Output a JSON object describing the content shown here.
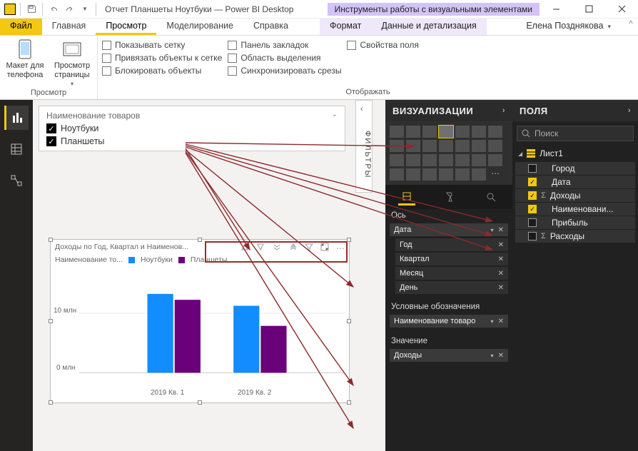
{
  "window": {
    "title": "Отчет Планшеты Ноутбуки — Power BI Desktop",
    "context_tools": "Инструменты работы с визуальными элементами",
    "user": "Елена Позднякова"
  },
  "tabs": {
    "file": "Файл",
    "home": "Главная",
    "view": "Просмотр",
    "modeling": "Моделирование",
    "help": "Справка",
    "format": "Формат",
    "data_detail": "Данные и детализация"
  },
  "ribbon": {
    "phone_layout": "Макет для телефона",
    "page_view": "Просмотр страницы",
    "group1_label": "Просмотр",
    "show_grid": "Показывать сетку",
    "snap_grid": "Привязать объекты к сетке",
    "lock_objects": "Блокировать объекты",
    "bookmarks_panel": "Панель закладок",
    "selection_pane": "Область выделения",
    "sync_slicers": "Синхронизировать срезы",
    "field_props": "Свойства поля",
    "group2_label": "Отображать"
  },
  "slicer": {
    "title": "Наименование товаров",
    "items": [
      "Ноутбуки",
      "Планшеты"
    ]
  },
  "filters_tab": "ФИЛЬТРЫ",
  "chart": {
    "title": "Доходы по Год, Квартал и Наименов...",
    "legend_label": "Наименование то...",
    "series1": "Ноутбуки",
    "series2": "Планшеты",
    "y_tick": "10 млн",
    "y_tick0": "0 млн",
    "x1": "2019 Кв. 1",
    "x2": "2019 Кв. 2"
  },
  "chart_data": {
    "type": "bar",
    "title": "Доходы по Год, Квартал и Наименование товаров",
    "series": [
      {
        "name": "Ноутбуки",
        "color": "#118dff",
        "values": [
          13.5,
          11.5
        ]
      },
      {
        "name": "Планшеты",
        "color": "#6b007b",
        "values": [
          12.5,
          8.0
        ]
      }
    ],
    "categories": [
      "2019 Кв. 1",
      "2019 Кв. 2"
    ],
    "ylabel": "млн",
    "ylim": [
      0,
      15
    ]
  },
  "panes": {
    "viz": "ВИЗУАЛИЗАЦИИ",
    "fields": "ПОЛЯ",
    "search_placeholder": "Поиск"
  },
  "wells": {
    "axis": "Ось",
    "axis_field": "Дата",
    "axis_sub": [
      "Год",
      "Квартал",
      "Месяц",
      "День"
    ],
    "legend": "Условные обозначения",
    "legend_field": "Наименование товаро",
    "value": "Значение",
    "value_field": "Доходы"
  },
  "fields_table": {
    "name": "Лист1",
    "fields": [
      {
        "label": "Город",
        "checked": false,
        "sigma": false
      },
      {
        "label": "Дата",
        "checked": true,
        "sigma": false
      },
      {
        "label": "Доходы",
        "checked": true,
        "sigma": true
      },
      {
        "label": "Наименовани...",
        "checked": true,
        "sigma": false
      },
      {
        "label": "Прибыль",
        "checked": false,
        "sigma": false
      },
      {
        "label": "Расходы",
        "checked": false,
        "sigma": true
      }
    ]
  }
}
